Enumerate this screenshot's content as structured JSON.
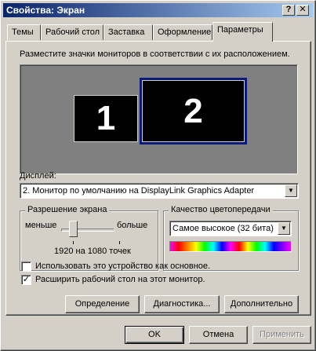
{
  "window": {
    "title": "Свойства: Экран"
  },
  "titlebar_buttons": {
    "help": "?",
    "close": "✕"
  },
  "tabs": [
    {
      "label": "Темы"
    },
    {
      "label": "Рабочий стол"
    },
    {
      "label": "Заставка"
    },
    {
      "label": "Оформление"
    },
    {
      "label": "Параметры",
      "active": true
    }
  ],
  "settings": {
    "instruction": "Разместите значки мониторов в соответствии с их расположением.",
    "monitors": [
      {
        "number": "1"
      },
      {
        "number": "2",
        "selected": true
      }
    ],
    "display_label": "Дисплей:",
    "display_value": "2. Монитор по умолчанию на DisplayLink Graphics Adapter",
    "resolution": {
      "title": "Разрешение экрана",
      "less": "меньше",
      "more": "больше",
      "value": "1920 на 1080 точек"
    },
    "color_quality": {
      "title": "Качество цветопередачи",
      "value": "Самое высокое (32 бита)"
    },
    "checkboxes": [
      {
        "label": "Использовать это устройство как основное.",
        "checked": false
      },
      {
        "label": "Расширить рабочий стол на этот монитор.",
        "checked": true
      }
    ],
    "buttons": {
      "identify": "Определение",
      "troubleshoot": "Диагностика...",
      "advanced": "Дополнительно"
    }
  },
  "footer": {
    "ok": "OK",
    "cancel": "Отмена",
    "apply": "Применить"
  },
  "icons": {
    "dropdown": "▼",
    "check": "✓"
  }
}
